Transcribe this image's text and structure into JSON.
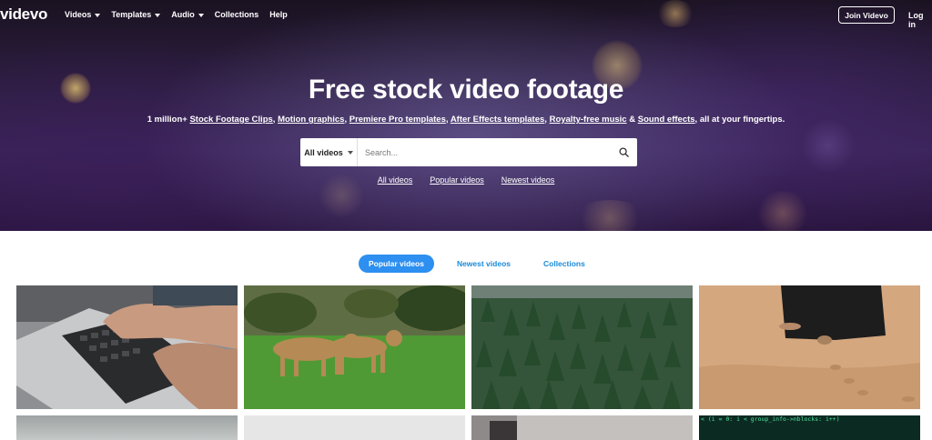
{
  "nav": {
    "logo": "videvo",
    "items": [
      {
        "label": "Videos",
        "has_dropdown": true
      },
      {
        "label": "Templates",
        "has_dropdown": true
      },
      {
        "label": "Audio",
        "has_dropdown": true
      },
      {
        "label": "Collections",
        "has_dropdown": false
      },
      {
        "label": "Help",
        "has_dropdown": false
      }
    ],
    "join_label": "Join Videvo",
    "login_label": "Log in"
  },
  "hero": {
    "title": "Free stock video footage",
    "subtitle": {
      "prefix": "1 million+ ",
      "links": [
        "Stock Footage Clips",
        "Motion graphics",
        "Premiere Pro templates",
        "After Effects templates",
        "Royalty-free music",
        "Sound effects"
      ],
      "sep1": ", ",
      "sep_amp": " & ",
      "suffix": ", all at your fingertips."
    },
    "search": {
      "category": "All videos",
      "placeholder": "Search..."
    },
    "quick_links": [
      "All videos",
      "Popular videos",
      "Newest videos"
    ]
  },
  "tabs": [
    {
      "label": "Popular videos",
      "active": true
    },
    {
      "label": "Newest videos",
      "active": false
    },
    {
      "label": "Collections",
      "active": false
    }
  ],
  "thumbnail_code_text": "< (i = 0: i < group_info->nblocks: i++)",
  "colors": {
    "accent": "#2d8ff0",
    "tab_link": "#1a8ad8"
  }
}
